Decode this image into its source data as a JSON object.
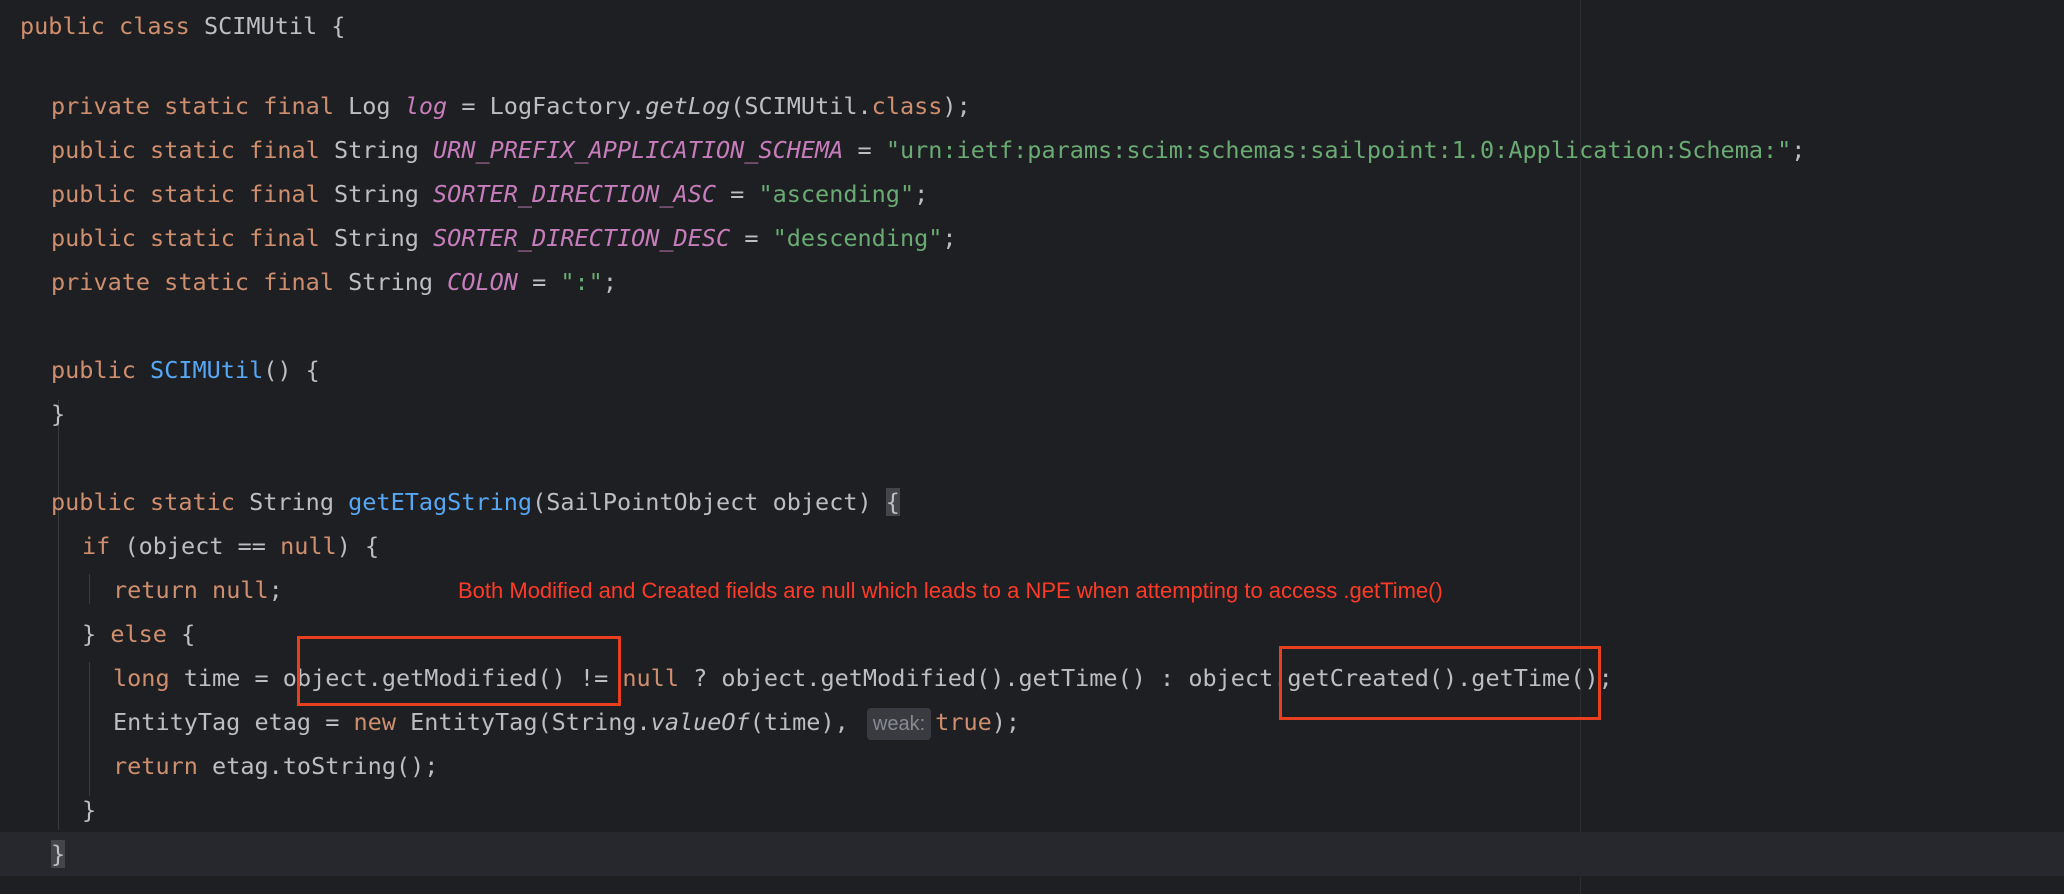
{
  "code": {
    "class_decl": {
      "public": "public",
      "class": "class",
      "name": "SCIMUtil",
      "brace": "{"
    },
    "log_line": {
      "mods": "private static final",
      "type": "Log",
      "field": "log",
      "eq": "=",
      "factory": "LogFactory.",
      "method": "getLog",
      "args_open": "(SCIMUtil.",
      "class_kw": "class",
      "end": ");"
    },
    "urn_line": {
      "mods": "public static final",
      "type": "String",
      "field": "URN_PREFIX_APPLICATION_SCHEMA",
      "eq": "=",
      "value": "\"urn:ietf:params:scim:schemas:sailpoint:1.0:Application:Schema:\"",
      "end": ";"
    },
    "asc_line": {
      "mods": "public static final",
      "type": "String",
      "field": "SORTER_DIRECTION_ASC",
      "eq": "=",
      "value": "\"ascending\"",
      "end": ";"
    },
    "desc_line": {
      "mods": "public static final",
      "type": "String",
      "field": "SORTER_DIRECTION_DESC",
      "eq": "=",
      "value": "\"descending\"",
      "end": ";"
    },
    "colon_line": {
      "mods": "private static final",
      "type": "String",
      "field": "COLON",
      "eq": "=",
      "value": "\":\"",
      "end": ";"
    },
    "ctor_line": {
      "mods": "public",
      "name": "SCIMUtil",
      "rest": "() {"
    },
    "ctor_close": "}",
    "method_line": {
      "mods": "public static",
      "type": "String",
      "name": "getETagString",
      "params": "(SailPointObject object)",
      "brace": "{"
    },
    "if_line": {
      "kw": "if",
      "cond_a": "(object == ",
      "null": "null",
      "cond_b": ") {"
    },
    "return_null": {
      "kw": "return",
      "null": "null",
      "end": ";"
    },
    "else_line": {
      "close": "}",
      "kw": "else",
      "open": "{"
    },
    "time_line": {
      "type": "long",
      "decl": "time =",
      "get_modified": "object.getModified()",
      "neq": "!=",
      "null": "null",
      "ternary": "? object.getModified().getTime() :",
      "get_created": "object.getCreated()",
      "tail": ".getTime();"
    },
    "etag_line": {
      "decl": "EntityTag etag =",
      "new": "new",
      "ctor": "EntityTag(String.",
      "value_of": "valueOf",
      "args": "(time),",
      "hint": "weak:",
      "true": "true",
      "end": ");"
    },
    "return_etag": {
      "kw": "return",
      "expr": "etag.toString();"
    },
    "else_close": "}",
    "method_close": "}"
  },
  "annotation": {
    "text": "Both Modified and Created fields are null which leads to a NPE when attempting to access .getTime()"
  },
  "colors": {
    "background": "#1e1f22",
    "keyword": "#cf8e6d",
    "string": "#6aab73",
    "static_field": "#c77dbb",
    "method_decl": "#56a8f5",
    "highlight_box": "#e8401e",
    "annotation_text": "#ff3b27"
  }
}
